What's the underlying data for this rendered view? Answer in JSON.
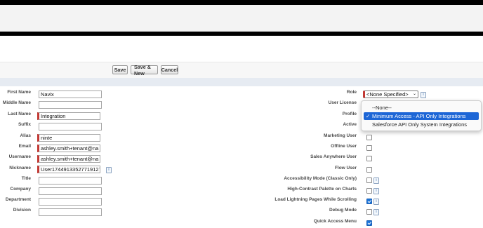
{
  "toolbar": {
    "save_label": "Save",
    "save_new_label": "Save & New",
    "cancel_label": "Cancel"
  },
  "left_fields": {
    "first_name": {
      "label": "First Name",
      "value": "Navix"
    },
    "middle_name": {
      "label": "Middle Name",
      "value": ""
    },
    "last_name": {
      "label": "Last Name",
      "value": "Integration"
    },
    "suffix": {
      "label": "Suffix",
      "value": ""
    },
    "alias": {
      "label": "Alias",
      "value": "ninte"
    },
    "email": {
      "label": "Email",
      "value": "ashley.smith+tenant@na"
    },
    "username": {
      "label": "Username",
      "value": "ashley.smith+tenant@na"
    },
    "nickname": {
      "label": "Nickname",
      "value": "User17449133527719127"
    },
    "title": {
      "label": "Title",
      "value": ""
    },
    "company": {
      "label": "Company",
      "value": ""
    },
    "department": {
      "label": "Department",
      "value": ""
    },
    "division": {
      "label": "Division",
      "value": ""
    }
  },
  "right_fields": {
    "role": {
      "label": "Role",
      "value": "<None Specified>"
    },
    "user_license": {
      "label": "User License"
    },
    "profile": {
      "label": "Profile"
    },
    "active": {
      "label": "Active"
    },
    "marketing_user": {
      "label": "Marketing User",
      "checked": false
    },
    "offline_user": {
      "label": "Offline User",
      "checked": false
    },
    "sales_anywhere_user": {
      "label": "Sales Anywhere User",
      "checked": false
    },
    "flow_user": {
      "label": "Flow User",
      "checked": false
    },
    "accessibility_mode": {
      "label": "Accessibility Mode (Classic Only)",
      "checked": false
    },
    "high_contrast": {
      "label": "High-Contrast Palette on Charts",
      "checked": false
    },
    "load_lightning": {
      "label": "Load Lightning Pages While Scrolling",
      "checked": true
    },
    "debug_mode": {
      "label": "Debug Mode",
      "checked": false
    },
    "quick_access_menu": {
      "label": "Quick Access Menu",
      "checked": true
    }
  },
  "profile_dropdown": {
    "options": [
      "--None--",
      "Minimum Access - API Only Integrations",
      "Salesforce API Only System Integrations"
    ],
    "selected": "Minimum Access - API Only Integrations",
    "check_glyph": "✓"
  },
  "icons": {
    "info": "i",
    "chevron": "⌄"
  },
  "colors": {
    "required": "#c23934",
    "selected": "#1d66d6",
    "checkbox_checked": "#1a73d9"
  }
}
